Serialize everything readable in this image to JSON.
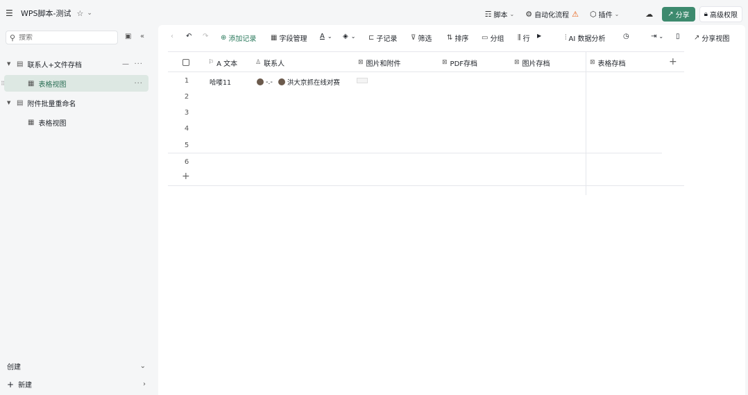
{
  "app": {
    "title": "WPS脚本-测试"
  },
  "topbar": {
    "script": "脚本",
    "automation": "自动化流程",
    "plugin": "插件",
    "share": "分享",
    "permission": "高级权限"
  },
  "sidebar": {
    "search_placeholder": "搜索",
    "items": [
      {
        "label": "联系人+文件存档",
        "expanded": true
      },
      {
        "label": "表格视图",
        "active": true
      },
      {
        "label": "附件批量重命名",
        "expanded": true
      },
      {
        "label": "表格视图",
        "active": false
      }
    ],
    "create_label": "创建",
    "new_label": "新建"
  },
  "toolbar": {
    "add_record": "添加记录",
    "field_manage": "字段管理",
    "sub_record": "子记录",
    "filter": "筛选",
    "sort": "排序",
    "group": "分组",
    "col_trunc": "行",
    "ai_analysis": "AI 数据分析",
    "share_view": "分享视图"
  },
  "table": {
    "columns": [
      {
        "label": "A 文本",
        "icon": "flag-icon"
      },
      {
        "label": "联系人",
        "icon": "person-icon"
      },
      {
        "label": "图片和附件",
        "icon": "image-icon"
      },
      {
        "label": "PDF存档",
        "icon": "image-icon"
      },
      {
        "label": "图片存档",
        "icon": "image-icon"
      },
      {
        "label": "表格存档",
        "icon": "image-icon"
      }
    ],
    "rows": [
      {
        "num": "1",
        "text": "哈喽11",
        "contact1": "-.-",
        "contact2": "洪大京抓在线对赛"
      },
      {
        "num": "2",
        "text": "",
        "contact1": "",
        "contact2": ""
      },
      {
        "num": "3",
        "text": "",
        "contact1": "",
        "contact2": ""
      },
      {
        "num": "4",
        "text": "",
        "contact1": "",
        "contact2": ""
      },
      {
        "num": "5",
        "text": "",
        "contact1": "",
        "contact2": ""
      },
      {
        "num": "6",
        "text": "",
        "contact1": "",
        "contact2": ""
      }
    ]
  },
  "colors": {
    "accent": "#3d8a6e",
    "active_bg": "#dde8e3",
    "warn": "#e8590c"
  }
}
